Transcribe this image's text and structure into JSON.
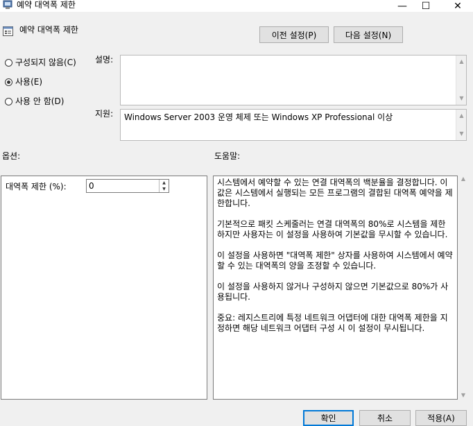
{
  "window": {
    "title": "예약 대역폭 제한",
    "minimize_glyph": "—",
    "maximize_glyph": "☐",
    "close_glyph": "✕"
  },
  "header": {
    "policy_name": "예약 대역폭 제한",
    "prev_setting_label": "이전 설정(P)",
    "next_setting_label": "다음 설정(N)"
  },
  "state": {
    "options": [
      {
        "label": "구성되지 않음(C)",
        "checked": false
      },
      {
        "label": "사용(E)",
        "checked": true
      },
      {
        "label": "사용 안 함(D)",
        "checked": false
      }
    ]
  },
  "comment": {
    "label": "설명:",
    "value": ""
  },
  "supported": {
    "label": "지원:",
    "value": "Windows Server 2003 운영 체제 또는 Windows XP Professional 이상"
  },
  "options_panel": {
    "heading": "옵션:",
    "bandwidth_label": "대역폭 제한 (%):",
    "bandwidth_value": "0"
  },
  "help_panel": {
    "heading": "도움말:",
    "text": "시스템에서 예약할 수 있는 연결 대역폭의 백분율을 결정합니다. 이 값은 시스템에서 실행되는 모든 프로그램의 결합된 대역폭 예약을 제한합니다.\n\n기본적으로 패킷 스케줄러는 연결 대역폭의 80%로 시스템을 제한하지만 사용자는 이 설정을 사용하여 기본값을 무시할 수 있습니다.\n\n이 설정을 사용하면 \"대역폭 제한\" 상자를 사용하여 시스템에서 예약할 수 있는 대역폭의 양을 조정할 수 있습니다.\n\n이 설정을 사용하지 않거나 구성하지 않으면 기본값으로 80%가 사용됩니다.\n\n중요: 레지스트리에 특정 네트워크 어댑터에 대한 대역폭 제한을 지정하면 해당 네트워크 어댑터 구성 시 이 설정이 무시됩니다."
  },
  "footer": {
    "ok_label": "확인",
    "cancel_label": "취소",
    "apply_label": "적용(A)"
  },
  "colors": {
    "accent": "#0078d7",
    "background": "#f0f0f0"
  }
}
